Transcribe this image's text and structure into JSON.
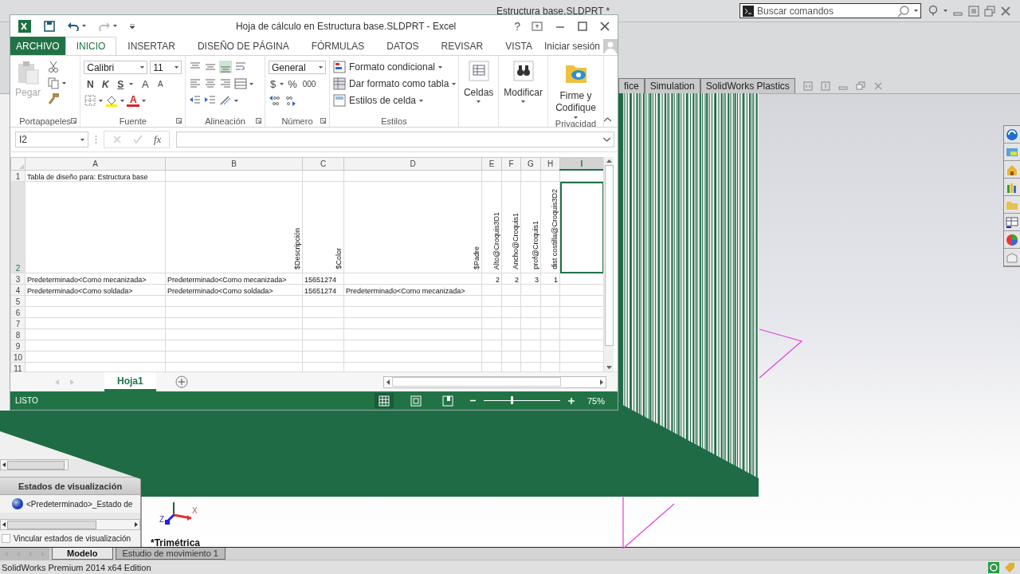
{
  "solidworks": {
    "title": "Estructura base.SLDPRT *",
    "search": {
      "placeholder": "Buscar comandos"
    },
    "command_tabs": [
      {
        "label": "fice",
        "selected": false
      },
      {
        "label": "Simulation",
        "selected": false
      },
      {
        "label": "SolidWorks Plastics",
        "selected": false
      }
    ],
    "panel": {
      "header": "Estados de visualización",
      "items": [
        {
          "label": "<Predeterminado>_Estado de",
          "selected": false
        }
      ],
      "link_checkbox": {
        "label": "Vincular estados de visualización",
        "checked": false
      }
    },
    "triad": {
      "x_label": "X",
      "z_label": "Z"
    },
    "view_label": "*Trimétrica",
    "bottom_tabs": [
      {
        "label": "Modelo",
        "selected": true
      },
      {
        "label": "Estudio de movimiento 1",
        "selected": false
      }
    ],
    "status_bar": "SolidWorks Premium 2014 x64 Edition"
  },
  "excel": {
    "title": "Hoja de cálculo en Estructura base.SLDPRT - Excel",
    "help_label": "?",
    "tabs": [
      {
        "label": "ARCHIVO",
        "kind": "file",
        "selected": false
      },
      {
        "label": "INICIO",
        "kind": "tab",
        "selected": true
      },
      {
        "label": "INSERTAR",
        "kind": "tab",
        "selected": false
      },
      {
        "label": "DISEÑO DE PÁGINA",
        "kind": "tab",
        "selected": false
      },
      {
        "label": "FÓRMULAS",
        "kind": "tab",
        "selected": false
      },
      {
        "label": "DATOS",
        "kind": "tab",
        "selected": false
      },
      {
        "label": "REVISAR",
        "kind": "tab",
        "selected": false
      },
      {
        "label": "VISTA",
        "kind": "tab",
        "selected": false
      }
    ],
    "sign_in": "Iniciar sesión",
    "groups": [
      {
        "kind": "clipboard",
        "label": "Portapapeles",
        "paste": "Pegar",
        "disabled": true
      },
      {
        "kind": "font",
        "label": "Fuente",
        "font": "Calibri",
        "size": "11",
        "styles": [
          "N",
          "K",
          "S"
        ],
        "grow": "A",
        "shrink": "A",
        "color_label": "A"
      },
      {
        "kind": "alignment",
        "label": "Alineación"
      },
      {
        "kind": "number",
        "label": "Número",
        "format": "General",
        "symbols": [
          "$",
          "%",
          "000"
        ]
      },
      {
        "kind": "styles",
        "label": "Estilos",
        "items": [
          "Formato condicional",
          "Dar formato como tabla",
          "Estilos de celda"
        ]
      },
      {
        "kind": "cells",
        "button": "Celdas"
      },
      {
        "kind": "editing",
        "button": "Modificar"
      },
      {
        "kind": "privacy",
        "label": "Privacidad",
        "button": "Firme y Codifique"
      }
    ],
    "name_box": "I2",
    "function_label": "fx",
    "columns": [
      {
        "label": "A",
        "selected": false
      },
      {
        "label": "B",
        "selected": false
      },
      {
        "label": "C",
        "selected": false
      },
      {
        "label": "D",
        "selected": false
      },
      {
        "label": "E",
        "selected": false
      },
      {
        "label": "F",
        "selected": false
      },
      {
        "label": "G",
        "selected": false
      },
      {
        "label": "H",
        "selected": false
      },
      {
        "label": "I",
        "selected": true
      }
    ],
    "rows": [
      {
        "number": "1",
        "selected": false,
        "kind": "data",
        "cells": [
          "Tabla de diseño para: Estructura base",
          null,
          null,
          null,
          null,
          null,
          null,
          null,
          null
        ]
      },
      {
        "number": "2",
        "selected": true,
        "kind": "vertical",
        "cells": [
          null,
          "$Descripción",
          "$Color",
          "$Padre",
          "Alto@Croquis3D1",
          "Ancho@Croquis1",
          "prof@Croquis1",
          "dist costilla@Croquis3D2",
          null
        ]
      },
      {
        "number": "3",
        "selected": false,
        "kind": "data",
        "cells": [
          "Predeterminado<Como mecanizada>",
          "Predeterminado<Como mecanizada>",
          "15651274",
          null,
          "2",
          "2",
          "3",
          "1",
          null
        ]
      },
      {
        "number": "4",
        "selected": false,
        "kind": "data",
        "cells": [
          "Predeterminado<Como soldada>",
          "Predeterminado<Como soldada>",
          "15651274",
          "Predeterminado<Como mecanizada>",
          null,
          null,
          null,
          null,
          null
        ]
      },
      {
        "number": "5",
        "selected": false,
        "kind": "data"
      },
      {
        "number": "6",
        "selected": false,
        "kind": "data"
      },
      {
        "number": "7",
        "selected": false,
        "kind": "data"
      },
      {
        "number": "8",
        "selected": false,
        "kind": "data"
      },
      {
        "number": "9",
        "selected": false,
        "kind": "data"
      },
      {
        "number": "10",
        "selected": false,
        "kind": "data"
      },
      {
        "number": "11",
        "selected": false,
        "kind": "data"
      }
    ],
    "sheets": [
      {
        "label": "Hoja1",
        "selected": true
      }
    ],
    "status": "LISTO",
    "views": [
      {
        "kind": "normal",
        "selected": true
      },
      {
        "kind": "layout",
        "selected": false
      },
      {
        "kind": "pagebreak",
        "selected": false
      }
    ],
    "zoom": {
      "level": 0.36,
      "reading": "75%"
    }
  }
}
